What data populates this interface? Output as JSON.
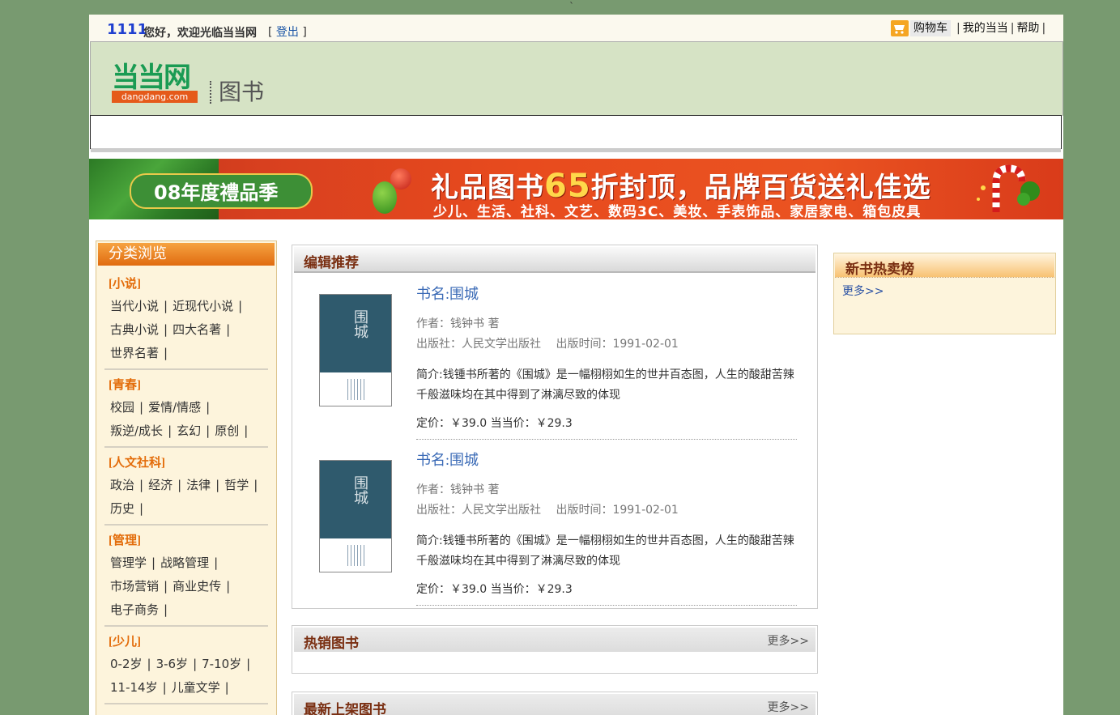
{
  "topbar": {
    "username": "1111",
    "welcome": "您好，欢迎光临当当网",
    "logout_open": "[ ",
    "logout": "登出",
    "logout_close": " ]",
    "cart": "购物车",
    "links": [
      "我的当当",
      "帮助"
    ],
    "sep": "|"
  },
  "header": {
    "logo_cn": "当当网",
    "logo_en": "dangdang.com",
    "section": "图书"
  },
  "banner": {
    "tag": "08年度禮品季",
    "headline_a": "礼品图书",
    "headline_num": "65",
    "headline_b": "折封顶，品牌百货送礼佳选",
    "subline": "少儿、生活、社科、文艺、数码3C、美妆、手表饰品、家居家电、箱包皮具"
  },
  "sidebar": {
    "title": "分类浏览",
    "categories": [
      {
        "title": "[小说]",
        "lines": [
          [
            "当代小说",
            "近现代小说"
          ],
          [
            "古典小说",
            "四大名著"
          ],
          [
            "世界名著"
          ]
        ]
      },
      {
        "title": "[青春]",
        "lines": [
          [
            "校园",
            "爱情/情感"
          ],
          [
            "叛逆/成长",
            "玄幻",
            "原创"
          ]
        ]
      },
      {
        "title": "[人文社科]",
        "lines": [
          [
            "政治",
            "经济",
            "法律",
            "哲学"
          ],
          [
            "历史"
          ]
        ]
      },
      {
        "title": "[管理]",
        "lines": [
          [
            "管理学",
            "战略管理"
          ],
          [
            "市场营销",
            "商业史传"
          ],
          [
            "电子商务"
          ]
        ]
      },
      {
        "title": "[少儿]",
        "lines": [
          [
            "0-2岁",
            "3-6岁",
            "7-10岁"
          ],
          [
            "11-14岁",
            "儿童文学"
          ]
        ]
      }
    ]
  },
  "recommend": {
    "title": "编辑推荐",
    "books": [
      {
        "cover_text": "围城",
        "name": "书名:围城",
        "author": "作者：钱钟书 著",
        "publisher": "出版社：人民文学出版社　 出版时间：1991-02-01",
        "desc": "简介:钱锺书所著的《围城》是一幅栩栩如生的世井百态图，人生的酸甜苦辣千般滋味均在其中得到了淋漓尽致的体现",
        "price": "定价：￥39.0  当当价：￥29.3"
      },
      {
        "cover_text": "围城",
        "name": "书名:围城",
        "author": "作者：钱钟书 著",
        "publisher": "出版社：人民文学出版社　 出版时间：1991-02-01",
        "desc": "简介:钱锺书所著的《围城》是一幅栩栩如生的世井百态图，人生的酸甜苦辣千般滋味均在其中得到了淋漓尽致的体现",
        "price": "定价：￥39.0  当当价：￥29.3"
      }
    ]
  },
  "hot": {
    "title": "热销图书",
    "more": "更多>>"
  },
  "newest": {
    "title": "最新上架图书",
    "more": "更多>>"
  },
  "rank": {
    "title": "新书热卖榜",
    "more": "更多>>"
  },
  "colors": {
    "background": "#789a70",
    "header": "#d6e3c5",
    "accent": "#e36c0a",
    "link": "#3a6ab6"
  }
}
